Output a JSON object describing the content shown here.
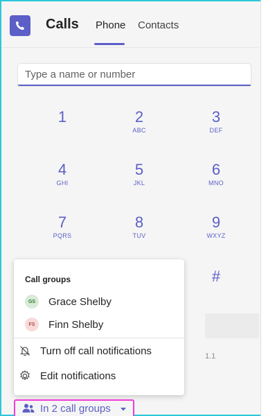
{
  "header": {
    "app_title": "Calls",
    "tabs": [
      {
        "label": "Phone",
        "active": true
      },
      {
        "label": "Contacts",
        "active": false
      }
    ]
  },
  "search": {
    "placeholder": "Type a name or number"
  },
  "keypad": [
    {
      "digit": "1",
      "letters": ""
    },
    {
      "digit": "2",
      "letters": "ABC"
    },
    {
      "digit": "3",
      "letters": "DEF"
    },
    {
      "digit": "4",
      "letters": "GHI"
    },
    {
      "digit": "5",
      "letters": "JKL"
    },
    {
      "digit": "6",
      "letters": "MNO"
    },
    {
      "digit": "7",
      "letters": "PQRS"
    },
    {
      "digit": "8",
      "letters": "TUV"
    },
    {
      "digit": "9",
      "letters": "WXYZ"
    },
    {
      "digit": "#",
      "letters": ""
    }
  ],
  "background_fragment": "1.1",
  "call_groups_popup": {
    "heading": "Call groups",
    "groups": [
      {
        "initials": "GS",
        "name": "Grace Shelby"
      },
      {
        "initials": "FS",
        "name": "Finn Shelby"
      }
    ],
    "actions": [
      {
        "label": "Turn off call notifications",
        "icon": "bell-off-icon"
      },
      {
        "label": "Edit notifications",
        "icon": "gear-icon"
      }
    ]
  },
  "call_groups_button": {
    "label": "In 2 call groups",
    "icon": "people-icon"
  },
  "colors": {
    "accent": "#5b5fc7",
    "focus_outline": "#f03ad8",
    "frame_border": "#2cc6d8"
  }
}
